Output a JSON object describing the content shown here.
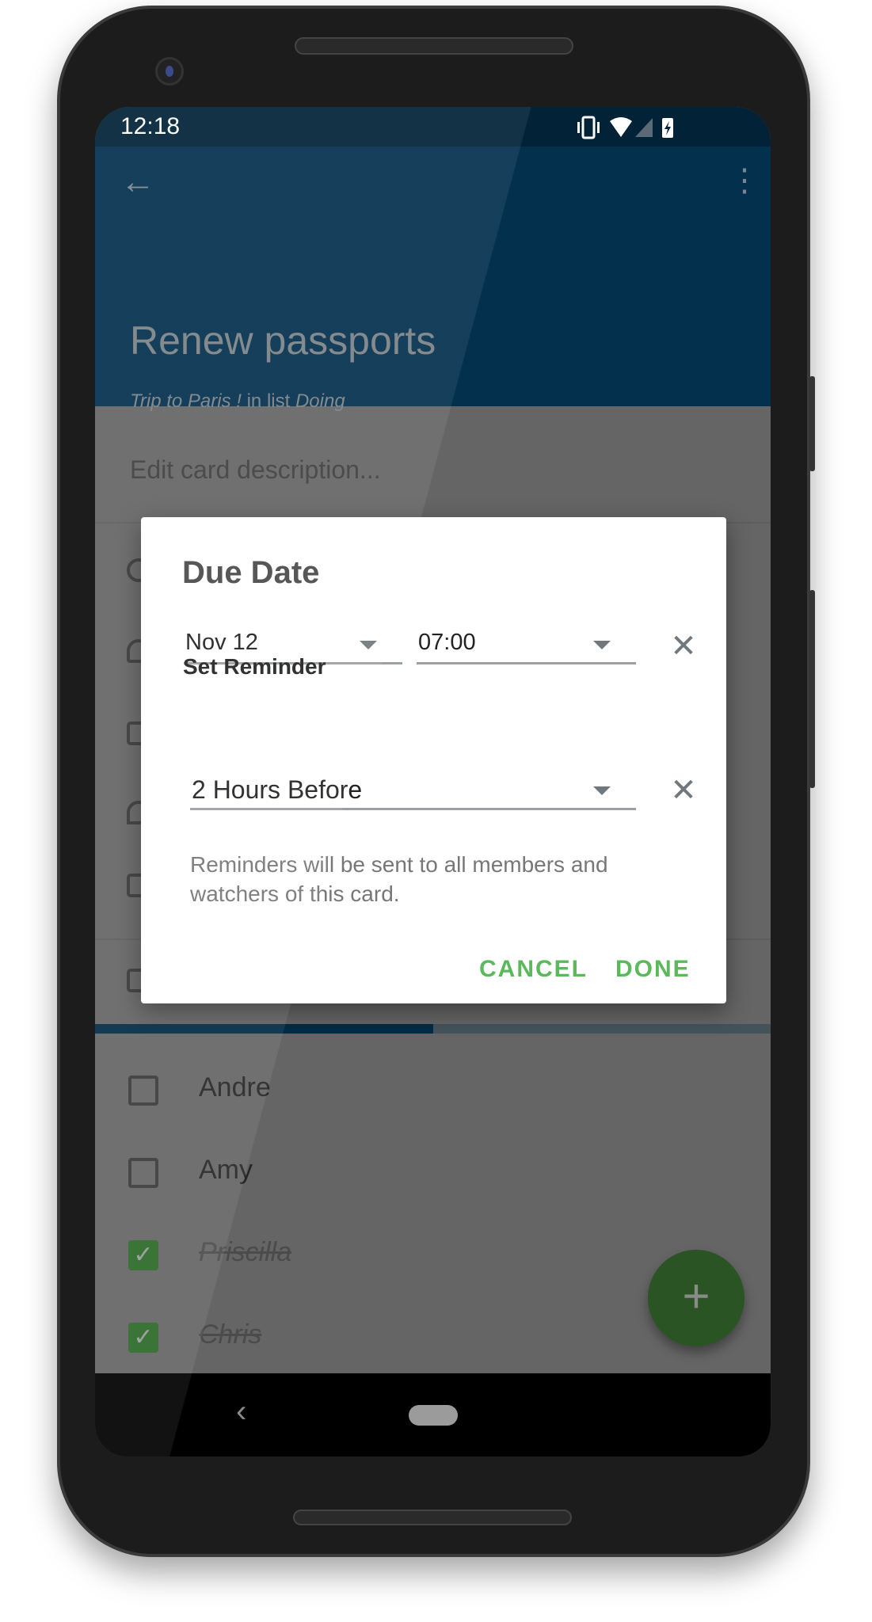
{
  "status_bar": {
    "time": "12:18",
    "icons": [
      "vibrate-icon",
      "wifi-icon",
      "signal-icon",
      "battery-charging-icon"
    ]
  },
  "app_bar": {
    "back_icon": "arrow-left-icon",
    "menu_icon": "more-vert-icon",
    "title": "Renew passports",
    "board": "Trip to Paris !",
    "in_list_text": "in list",
    "list": "Doing"
  },
  "card": {
    "description_placeholder": "Edit card description..."
  },
  "checklist": {
    "progress": 0.5,
    "items": [
      {
        "label": "Andre",
        "checked": false
      },
      {
        "label": "Amy",
        "checked": false
      },
      {
        "label": "Priscilla",
        "checked": true
      },
      {
        "label": "Chris",
        "checked": true
      }
    ]
  },
  "fab": {
    "icon": "plus-icon",
    "label": "+"
  },
  "dialog": {
    "title": "Due Date",
    "date_value": "Nov 12",
    "time_value": "07:00",
    "reminder_label": "Set Reminder",
    "reminder_value": "2 Hours Before",
    "help_text": "Reminders will be sent to all members and watchers of this card.",
    "cancel_label": "CANCEL",
    "done_label": "DONE",
    "clear_glyph": "✕"
  },
  "colors": {
    "app_bar": "#03304d",
    "accent": "#5cb85c",
    "fab": "#2a5423",
    "progress": "#022b47"
  }
}
